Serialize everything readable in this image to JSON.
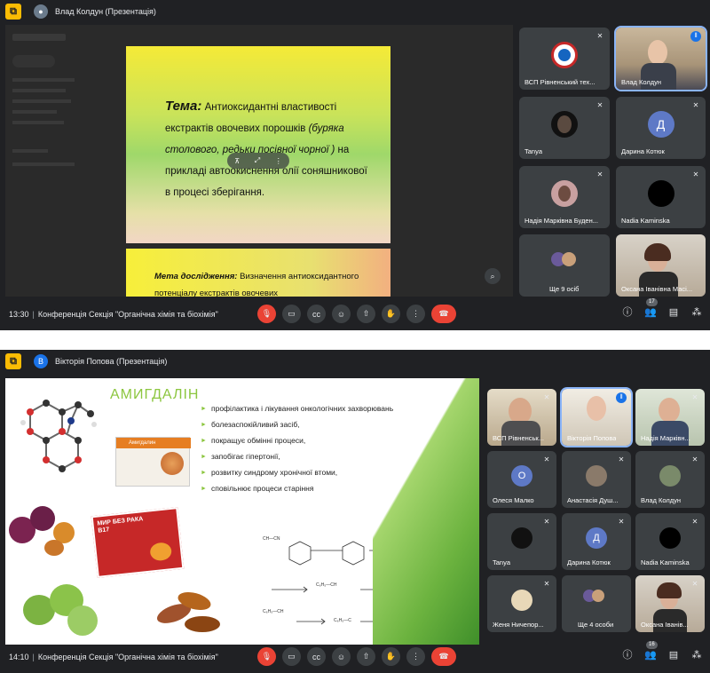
{
  "screens": [
    {
      "presenter": "Влад Колдун (Презентація)",
      "presenter_initial": "",
      "time": "13:30",
      "meeting": "Конференція Секція \"Органічна хімія та біохімія\"",
      "people_count": "17",
      "slide": {
        "topic_label": "Тема:",
        "topic_text_1": "Антиоксидантні властивості екстрактів овочевих порошків ",
        "topic_italic": "(буряка столового, редьки посівної чорної )",
        "topic_text_2": " на прикладі автоокиснення олії соняшникової в процесі зберігання.",
        "goal_label": "Мета дослідження:",
        "goal_text": " Визначення антиоксидантного потенціалу екстрактів овочевих"
      },
      "tiles": [
        {
          "name": "ВСП Рівненський тех...",
          "muted": true
        },
        {
          "name": "Влад Колдун",
          "speaking": true
        },
        {
          "name": "Tanya",
          "muted": true
        },
        {
          "name": "Дарина Котюк",
          "initial": "Д",
          "muted": true
        },
        {
          "name": "Надія Марківна Буден...",
          "muted": true
        },
        {
          "name": "Nadia Kaminska",
          "muted": true
        },
        {
          "name": "Ще 9 осіб"
        },
        {
          "name": "Оксана Іванівна Масі..."
        }
      ]
    },
    {
      "presenter": "Вікторія Попова (Презентація)",
      "presenter_initial": "В",
      "time": "14:10",
      "meeting": "Конференція Секція \"Органічна хімія та біохімія\"",
      "people_count": "16",
      "slide": {
        "title": "АМИГДАЛІН",
        "bullets": [
          "профілактика і лікування онкологічних захворювань",
          "болезаспокійливий засіб,",
          "покращує обмінні процеси,",
          "запобігає гіпертонії,",
          "розвитку синдрому хронічної втоми,",
          "сповільнює процеси старіння"
        ],
        "box_label": "Амигдалин",
        "book_title": "МИР БЕЗ РАКА B17"
      },
      "tiles": [
        {
          "name": "ВСП Рівненськ...",
          "muted": true
        },
        {
          "name": "Вікторія Попова",
          "speaking": true
        },
        {
          "name": "Надія Марківн...",
          "muted": true
        },
        {
          "name": "Олеся Малко",
          "initial": "О",
          "muted": true
        },
        {
          "name": "Анастасія Душ...",
          "muted": true
        },
        {
          "name": "Влад Колдун",
          "muted": true
        },
        {
          "name": "Tanya",
          "muted": true
        },
        {
          "name": "Дарина Котюк",
          "initial": "Д",
          "muted": true
        },
        {
          "name": "Nadia Kaminska",
          "muted": true
        },
        {
          "name": "Женя Ничепор...",
          "muted": true
        },
        {
          "name": "Ще 4 особи"
        },
        {
          "name": "Оксана Іванів...",
          "muted": true
        }
      ]
    }
  ],
  "colors": {
    "bg": "#202124",
    "tile": "#3c4043",
    "red": "#ea4335",
    "blue": "#1a73e8",
    "slide_green": "#8cc63f",
    "darina_avatar": "#5e79c6",
    "olesia_avatar": "#5e79c6"
  },
  "icons": [
    "mic-off-icon",
    "camera-icon",
    "captions-icon",
    "emoji-icon",
    "present-icon",
    "raise-hand-icon",
    "more-icon",
    "end-call-icon",
    "info-icon",
    "people-icon",
    "chat-icon",
    "activities-icon"
  ]
}
